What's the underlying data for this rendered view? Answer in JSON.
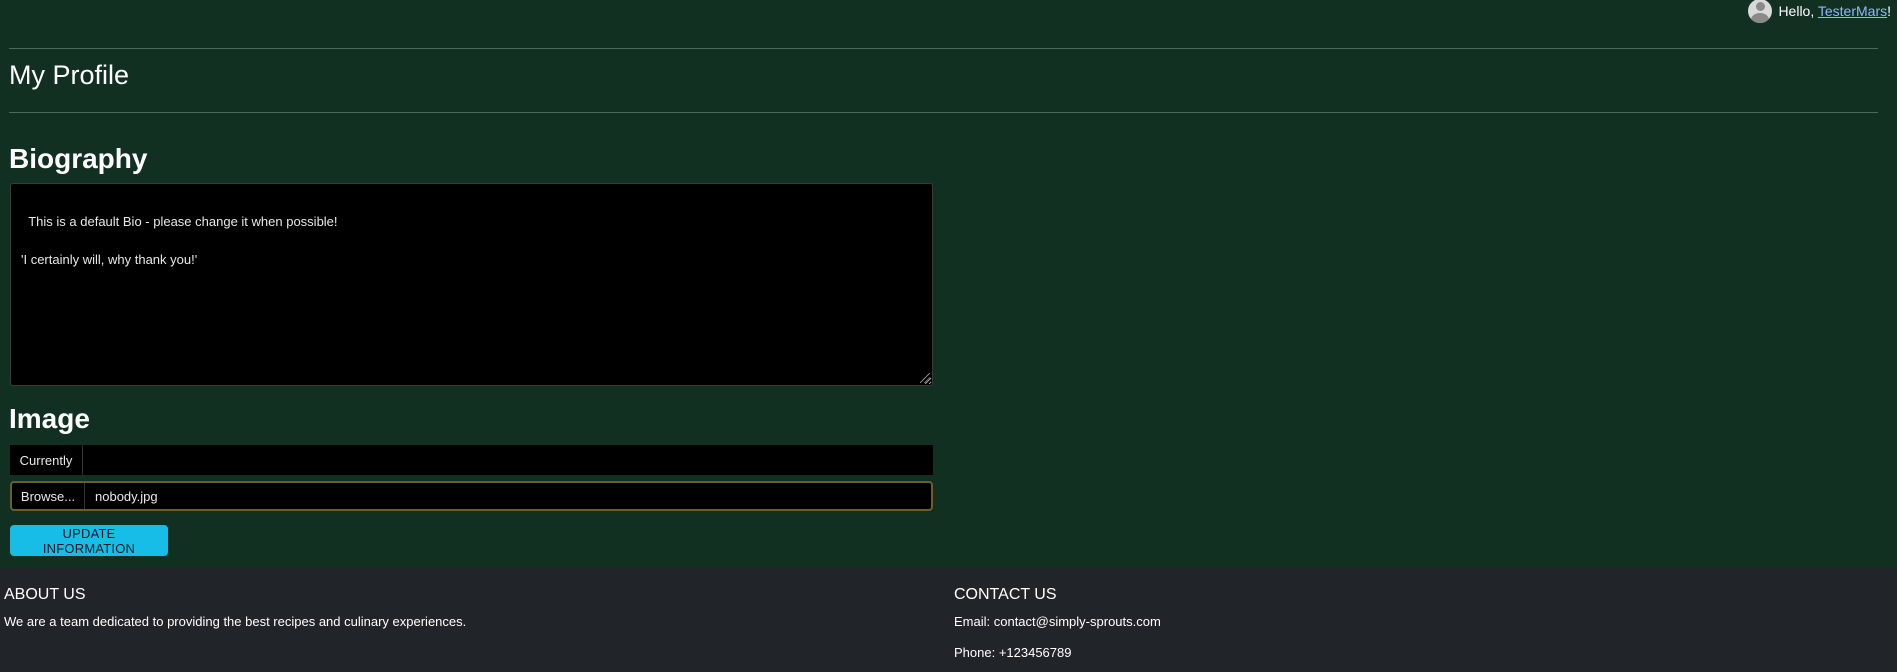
{
  "user": {
    "greeting": "Hello, ",
    "username": "TesterMars",
    "suffix": "!"
  },
  "page": {
    "title": "My Profile"
  },
  "biography": {
    "heading": "Biography",
    "text": "This is a default Bio - please change it when possible!\n\n'I certainly will, why thank you!'"
  },
  "image": {
    "heading": "Image",
    "currently_label": "Currently",
    "currently_value": "",
    "browse_label": "Browse...",
    "file_name": "nobody.jpg"
  },
  "actions": {
    "update_label": "UPDATE INFORMATION"
  },
  "footer": {
    "about_heading": "ABOUT US",
    "about_text": "We are a team dedicated to providing the best recipes and culinary experiences.",
    "contact_heading": "CONTACT US",
    "email": "Email: contact@simply-sprouts.com",
    "phone": "Phone: +123456789"
  },
  "colors": {
    "page_bg": "#123021",
    "footer_bg": "#212529",
    "button_bg": "#17bde6",
    "link": "#8fb6ff"
  },
  "icons": {
    "avatar": "user-avatar-icon"
  }
}
